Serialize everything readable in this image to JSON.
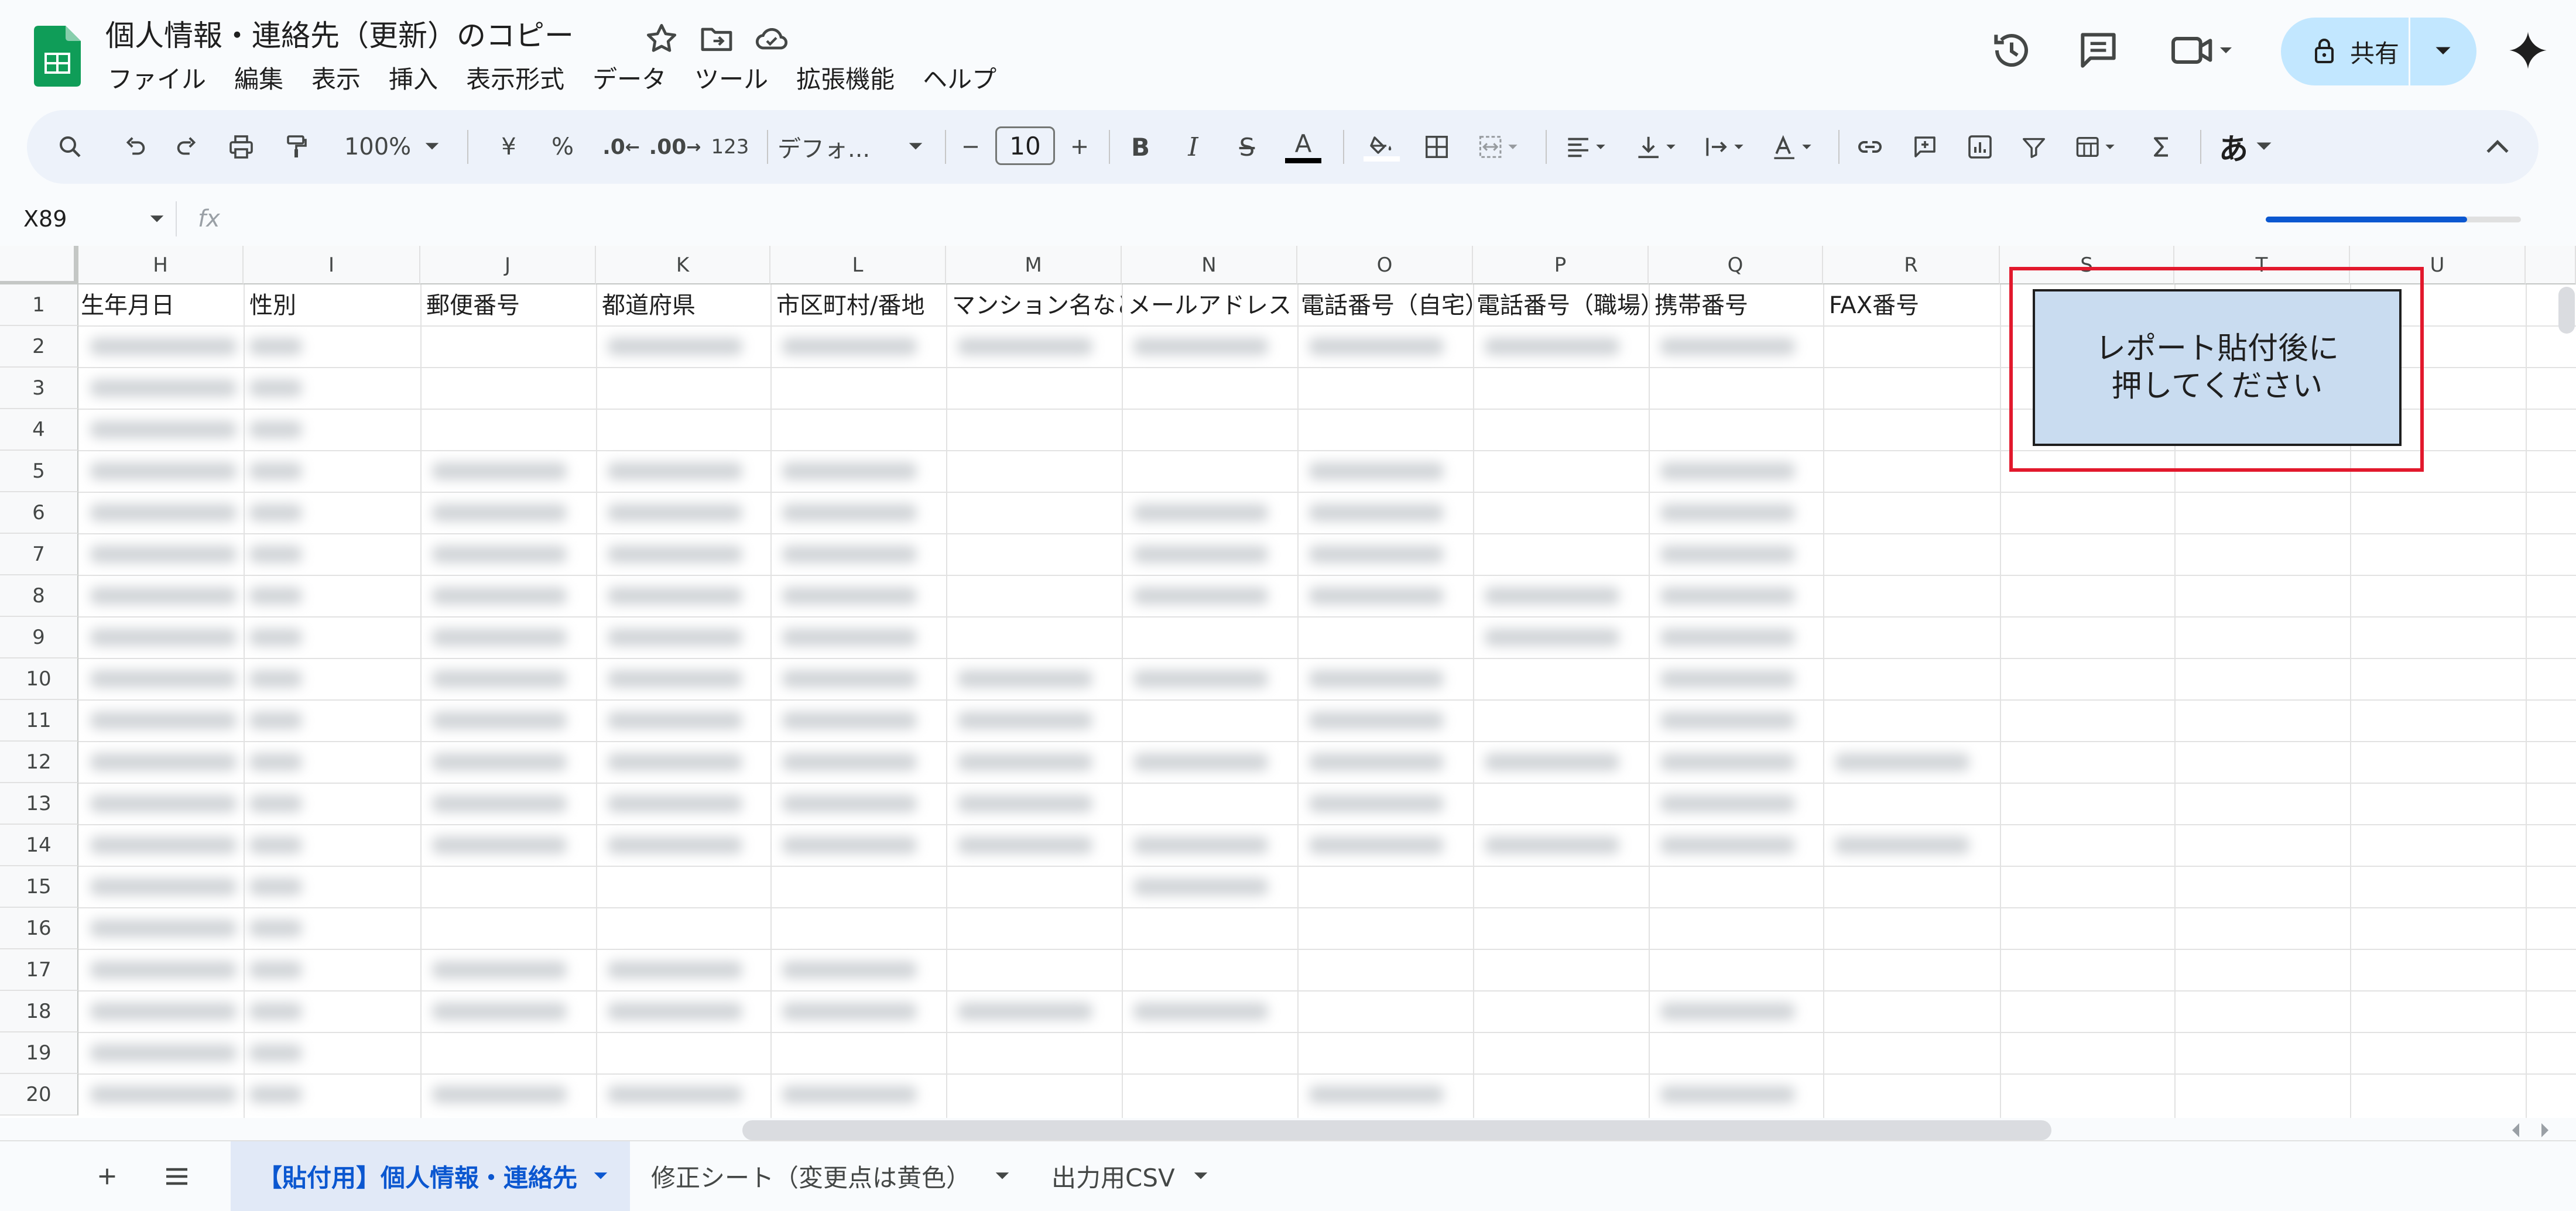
{
  "document": {
    "title": "個人情報・連絡先（更新）のコピー"
  },
  "menu": [
    "ファイル",
    "編集",
    "表示",
    "挿入",
    "表示形式",
    "データ",
    "ツール",
    "拡張機能",
    "ヘルプ"
  ],
  "share": {
    "label": "共有"
  },
  "toolbar": {
    "zoom": "100%",
    "currency": "¥",
    "percent": "%",
    "decrease_decimal": ".0",
    "increase_decimal": ".00",
    "number_format": "123",
    "font": "デフォ...",
    "font_size": "10",
    "bold": "B",
    "italic": "I",
    "strikethrough": "S",
    "text_color": "A",
    "input_tools": "あ"
  },
  "formula_bar": {
    "name_box": "X89",
    "fx": "fx",
    "progress": 0.79
  },
  "grid": {
    "columns": [
      "H",
      "I",
      "J",
      "K",
      "L",
      "M",
      "N",
      "O",
      "P",
      "Q",
      "R",
      "S",
      "T",
      "U"
    ],
    "rows": [
      "1",
      "2",
      "3",
      "4",
      "5",
      "6",
      "7",
      "8",
      "9",
      "10",
      "11",
      "12",
      "13",
      "14",
      "15",
      "16",
      "17",
      "18",
      "19",
      "20"
    ],
    "header_row": [
      "生年月日",
      "性別",
      "郵便番号",
      "都道府県",
      "市区町村/番地",
      "マンション名など",
      "メールアドレス",
      "電話番号（自宅）",
      "電話番号（職場）",
      "携帯番号",
      "FAX番号"
    ]
  },
  "macro_button": {
    "line1": "レポート貼付後に",
    "line2": "押してください"
  },
  "sheets": {
    "tabs": [
      "【貼付用】個人情報・連絡先",
      "修正シート（変更点は黄色）",
      "出力用CSV"
    ],
    "active_index": 0
  },
  "colors": {
    "accent": "#0b57d0",
    "share_bg": "#c2e7ff",
    "highlight": "#e2192d",
    "macro_bg": "#c9dcf0",
    "logo": "#0f9d58"
  }
}
